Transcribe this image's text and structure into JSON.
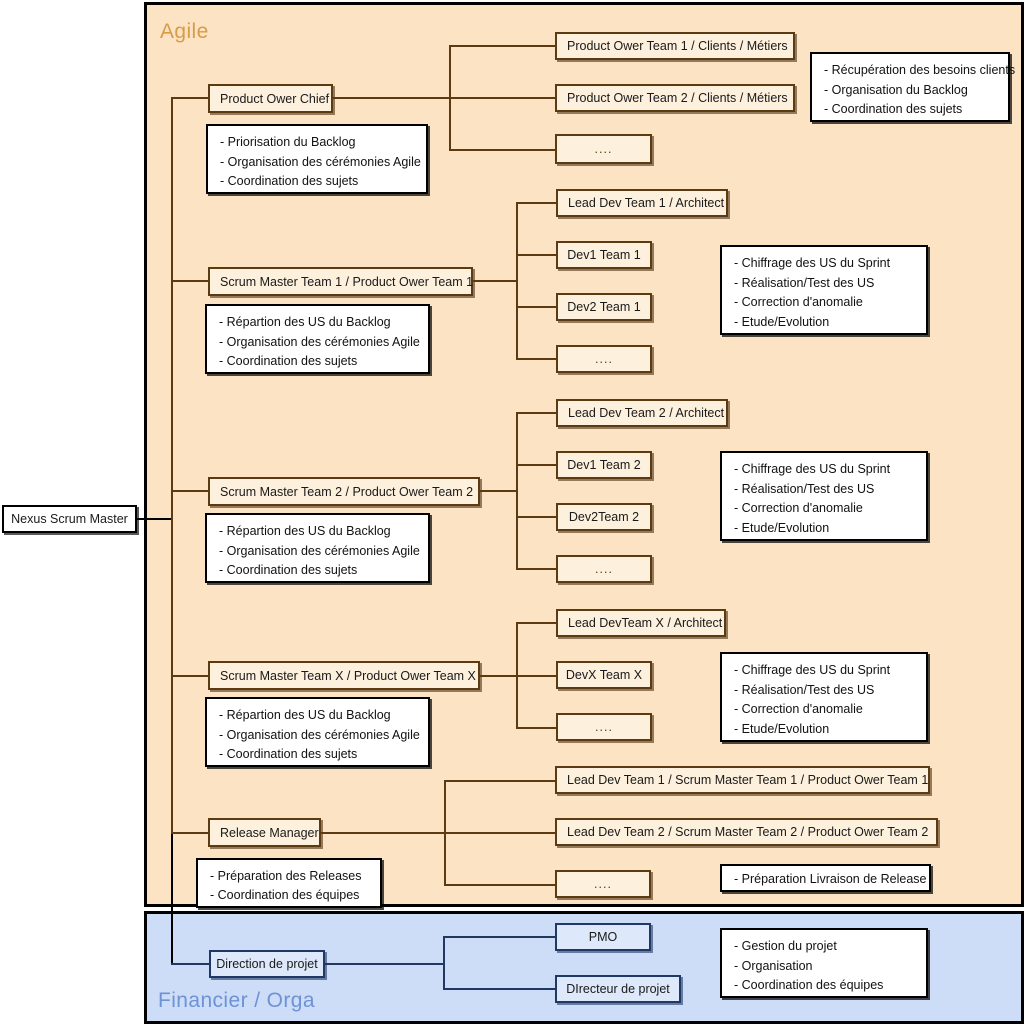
{
  "panels": {
    "agile": {
      "title": "Agile"
    },
    "financier": {
      "title": "Financier / Orga"
    }
  },
  "root": {
    "label": "Nexus Scrum Master"
  },
  "agile": {
    "product_owner": {
      "chief": {
        "label": "Product Ower Chief"
      },
      "chief_note": [
        "- Priorisation du Backlog",
        "- Organisation des cérémonies Agile",
        "- Coordination des sujets"
      ],
      "children": [
        {
          "label": "Product Ower Team 1 / Clients / Métiers"
        },
        {
          "label": "Product Ower Team 2 / Clients / Métiers"
        },
        {
          "label": "...."
        }
      ],
      "children_note": [
        "- Récupération des besoins clients",
        "- Organisation du Backlog",
        "- Coordination des sujets"
      ]
    },
    "scrum_teams": [
      {
        "label": "Scrum Master Team 1 / Product Ower Team 1",
        "note": [
          "- Répartion des US du Backlog",
          "- Organisation des cérémonies Agile",
          "- Coordination des sujets"
        ],
        "members": [
          {
            "label": "Lead Dev Team 1 / Architect"
          },
          {
            "label": "Dev1 Team 1"
          },
          {
            "label": "Dev2 Team 1"
          },
          {
            "label": "...."
          }
        ],
        "members_note": [
          "- Chiffrage des US du Sprint",
          "- Réalisation/Test des US",
          "- Correction d'anomalie",
          "- Etude/Evolution"
        ]
      },
      {
        "label": "Scrum Master Team 2 / Product Ower Team 2",
        "note": [
          "- Répartion des US du Backlog",
          "- Organisation des cérémonies Agile",
          "- Coordination des sujets"
        ],
        "members": [
          {
            "label": "Lead Dev Team 2 / Architect"
          },
          {
            "label": "Dev1 Team 2"
          },
          {
            "label": "Dev2Team 2"
          },
          {
            "label": "...."
          }
        ],
        "members_note": [
          "- Chiffrage des US du Sprint",
          "- Réalisation/Test des US",
          "- Correction d'anomalie",
          "- Etude/Evolution"
        ]
      },
      {
        "label": "Scrum Master Team X / Product Ower Team X",
        "note": [
          "- Répartion des US du Backlog",
          "- Organisation des cérémonies Agile",
          "- Coordination des sujets"
        ],
        "members": [
          {
            "label": "Lead DevTeam X / Architect"
          },
          {
            "label": "DevX Team X"
          },
          {
            "label": "...."
          }
        ],
        "members_note": [
          "- Chiffrage des US du Sprint",
          "- Réalisation/Test des US",
          "- Correction d'anomalie",
          "- Etude/Evolution"
        ]
      }
    ],
    "release": {
      "manager": {
        "label": "Release Manager"
      },
      "manager_note": [
        "- Préparation des Releases",
        "- Coordination des équipes"
      ],
      "children": [
        {
          "label": "Lead Dev Team 1 / Scrum Master Team 1 / Product Ower Team 1"
        },
        {
          "label": "Lead Dev Team 2 / Scrum Master Team 2 / Product Ower Team 2"
        },
        {
          "label": "...."
        }
      ],
      "children_note": [
        "- Préparation Livraison de Release"
      ]
    }
  },
  "financier": {
    "direction": {
      "label": "Direction de projet"
    },
    "children": [
      {
        "label": "PMO"
      },
      {
        "label": "DIrecteur de projet"
      }
    ],
    "children_note": [
      "- Gestion du projet",
      "- Organisation",
      "- Coordination des équipes"
    ]
  },
  "colors": {
    "agile_background": "#fce3c3",
    "agile_title": "#d99b4a",
    "agile_node_fill": "#fdf0dc",
    "agile_node_border": "#5c3a12",
    "financier_background": "#cdddf7",
    "financier_title": "#6d92d6",
    "financier_node_fill": "#dde8fa",
    "financier_node_border": "#1f3864",
    "note_background": "#ffffff",
    "note_border": "#000000"
  }
}
